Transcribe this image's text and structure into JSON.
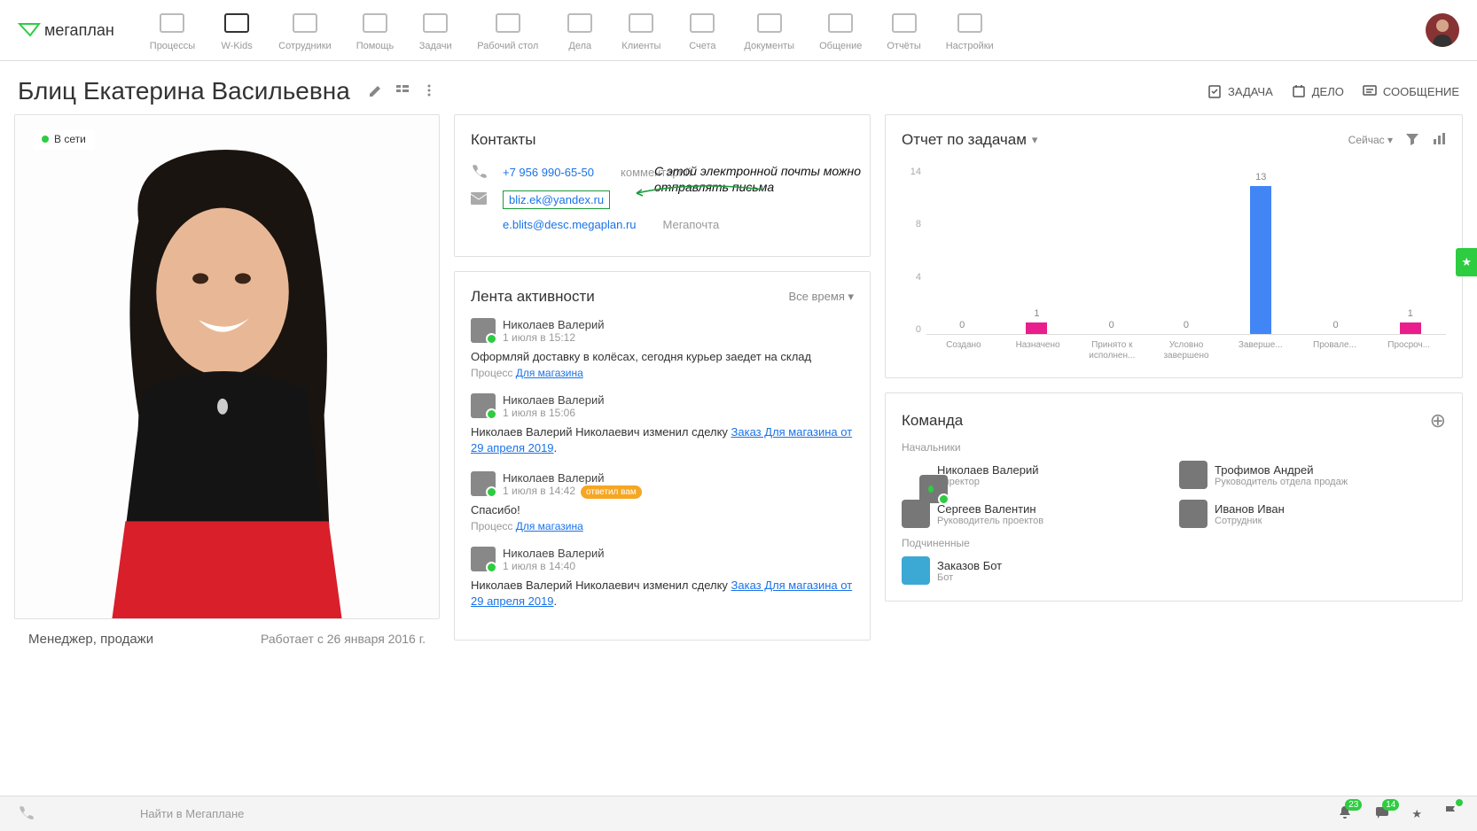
{
  "logo": "мегаплан",
  "nav": [
    {
      "label": "Процессы"
    },
    {
      "label": "W-Kids"
    },
    {
      "label": "Сотрудники"
    },
    {
      "label": "Помощь"
    },
    {
      "label": "Задачи"
    },
    {
      "label": "Рабочий стол"
    },
    {
      "label": "Дела"
    },
    {
      "label": "Клиенты"
    },
    {
      "label": "Счета"
    },
    {
      "label": "Документы"
    },
    {
      "label": "Общение"
    },
    {
      "label": "Отчёты"
    },
    {
      "label": "Настройки"
    }
  ],
  "page_title": "Блиц Екатерина Васильевна",
  "actions": {
    "task": "ЗАДАЧА",
    "deal": "ДЕЛО",
    "msg": "СООБЩЕНИЕ"
  },
  "profile": {
    "online": "В сети",
    "role": "Менеджер, продажи",
    "since": "Работает с 26 января 2016 г."
  },
  "contacts": {
    "title": "Контакты",
    "phone": "+7 956 990-65-50",
    "phone_note": "комментарий",
    "email1": "bliz.ek@yandex.ru",
    "email2": "e.blits@desc.megaplan.ru",
    "email2_note": "Мегапочта",
    "annot_l1": "С этой электронной почты можно",
    "annot_l2": "отправлять письма"
  },
  "activity": {
    "title": "Лента активности",
    "filter": "Все время",
    "items": [
      {
        "name": "Николаев Валерий",
        "date": "1 июля в 15:12",
        "body": "Оформляй доставку в колёсах, сегодня курьер заедет на склад",
        "sub_pre": "Процесс ",
        "sub_link": "Для магазина"
      },
      {
        "name": "Николаев Валерий",
        "date": "1 июля в 15:06",
        "body_pre": "Николаев Валерий Николаевич изменил сделку ",
        "body_link": "Заказ Для магазина от 29 апреля 2019",
        "body_post": "."
      },
      {
        "name": "Николаев Валерий",
        "date": "1 июля в 14:42",
        "badge": "ответил вам",
        "body": "Спасибо!",
        "sub_pre": "Процесс ",
        "sub_link": "Для магазина"
      },
      {
        "name": "Николаев Валерий",
        "date": "1 июля в 14:40",
        "body_pre": "Николаев Валерий Николаевич изменил сделку ",
        "body_link": "Заказ Для магазина от 29 апреля 2019",
        "body_post": "."
      }
    ]
  },
  "report": {
    "title": "Отчет по задачам",
    "now": "Сейчас"
  },
  "chart_data": {
    "type": "bar",
    "categories": [
      "Создано",
      "Назначено",
      "Принято к исполнен...",
      "Условно завершено",
      "Заверше...",
      "Провале...",
      "Просроч..."
    ],
    "values": [
      0,
      1,
      0,
      0,
      13,
      0,
      1
    ],
    "yticks": [
      14,
      8,
      4,
      0
    ],
    "ylim": [
      0,
      14
    ],
    "highlight_index": 4,
    "colors": {
      "default": "#e91e8c",
      "highlight": "#4285f4"
    }
  },
  "team": {
    "title": "Команда",
    "sec1": "Начальники",
    "bosses": [
      {
        "name": "Николаев Валерий",
        "role": "Директор",
        "online": true
      },
      {
        "name": "Трофимов Андрей",
        "role": "Руководитель отдела продаж"
      },
      {
        "name": "Сергеев Валентин",
        "role": "Руководитель проектов"
      },
      {
        "name": "Иванов Иван",
        "role": "Сотрудник"
      }
    ],
    "sec2": "Подчиненные",
    "subs": [
      {
        "name": "Заказов Бот",
        "role": "Бот",
        "bot": true
      }
    ]
  },
  "bottom": {
    "search": "Найти в Мегаплане",
    "count1": "23",
    "count2": "14"
  }
}
